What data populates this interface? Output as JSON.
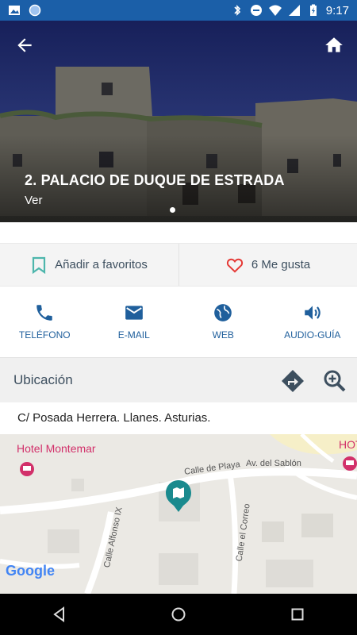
{
  "status_bar": {
    "time": "9:17",
    "icons": [
      "image-icon",
      "globe-notification-icon",
      "bluetooth-icon",
      "do-not-disturb-icon",
      "wifi-icon",
      "signal-icon",
      "battery-charging-icon"
    ],
    "background": "#1b5fa8"
  },
  "hero": {
    "title": "2. PALACIO DE DUQUE DE ESTRADA",
    "subtitle": "Ver",
    "back_icon": "arrow-left-icon",
    "home_icon": "home-icon",
    "pager_dots": 1
  },
  "actions": {
    "favorites_label": "Añadir a favoritos",
    "likes_label": "6 Me gusta",
    "bookmark_color": "#4db6ac",
    "heart_color": "#e53935"
  },
  "contact": {
    "items": [
      {
        "label": "TELÉFONO",
        "icon": "phone-icon"
      },
      {
        "label": "E-MAIL",
        "icon": "email-icon"
      },
      {
        "label": "WEB",
        "icon": "globe-icon"
      },
      {
        "label": "AUDIO-GUÍA",
        "icon": "volume-icon"
      }
    ],
    "accent": "#1f5f9c"
  },
  "location": {
    "title": "Ubicación",
    "address": "C/ Posada Herrera. Llanes. Asturias.",
    "directions_icon": "directions-icon",
    "zoom_icon": "zoom-in-icon"
  },
  "map": {
    "poi_hotel": "Hotel Montemar",
    "poi_hotel_right": "HOT",
    "streets": [
      "Calle de Playa",
      "Av. del Sablón",
      "Calle Alfonso IX",
      "Calle el Correo"
    ],
    "attribution": "Google",
    "marker_color": "#1a8a8e"
  },
  "nav_bar": {
    "icons": [
      "back-triangle-icon",
      "home-circle-icon",
      "recents-square-icon"
    ]
  }
}
